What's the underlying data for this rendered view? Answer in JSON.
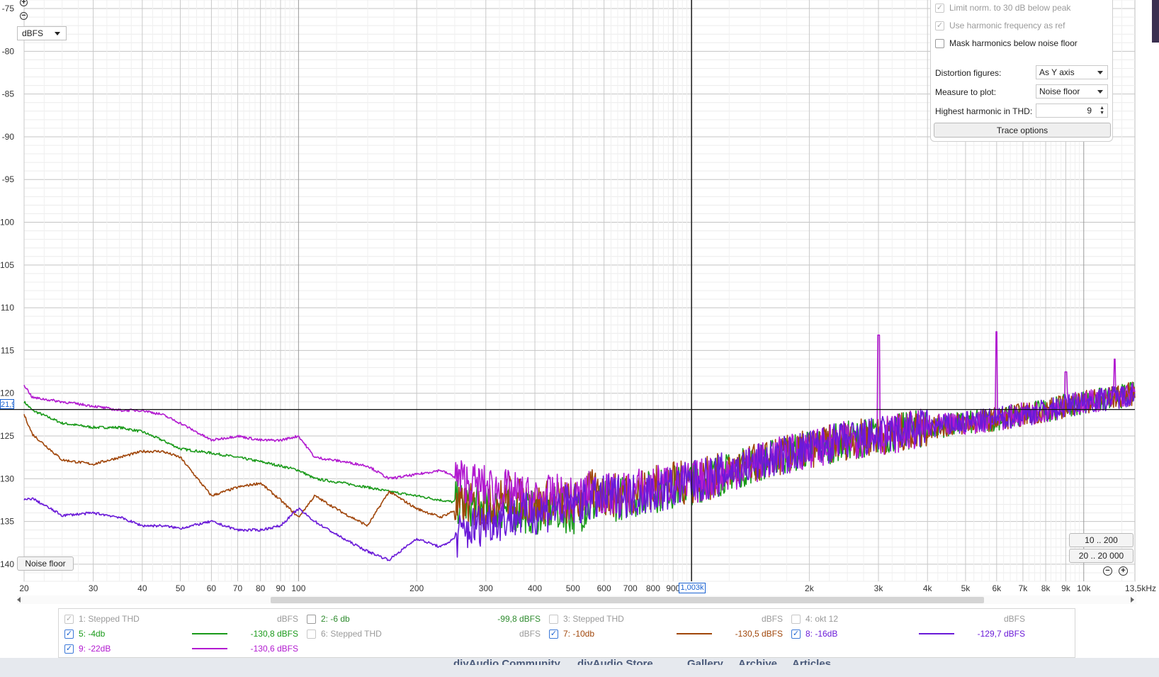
{
  "controls": {
    "unit_select": "dBFS",
    "noise_floor_button": "Noise floor",
    "range_btn_1": "10 .. 200",
    "range_btn_2": "20 .. 20 000",
    "cursor_y_label": "21,9",
    "cursor_x_label": "1,003k"
  },
  "panel": {
    "opt_limit": "Limit norm. to 30 dB below peak",
    "opt_harmonic_ref": "Use harmonic frequency as ref",
    "opt_mask": "Mask harmonics below noise floor",
    "distortion_label": "Distortion figures:",
    "distortion_value": "As Y axis",
    "measure_label": "Measure to plot:",
    "measure_value": "Noise floor",
    "highest_label": "Highest harmonic in THD:",
    "highest_value": "9",
    "trace_options": "Trace options"
  },
  "legend": [
    {
      "name": "1: Stepped THD",
      "value": "dBFS",
      "checked": true,
      "enabled": false,
      "color": "#9a9a9a"
    },
    {
      "name": "2: -6 db",
      "value": "-99,8 dBFS",
      "checked": false,
      "enabled": true,
      "color": "#2e8b2e"
    },
    {
      "name": "3: Stepped THD",
      "value": "dBFS",
      "checked": false,
      "enabled": false,
      "color": "#9a9a9a"
    },
    {
      "name": "4: okt 12",
      "value": "dBFS",
      "checked": false,
      "enabled": false,
      "color": "#9a9a9a"
    },
    {
      "name": "5: -4db",
      "value": "-130,8 dBFS",
      "checked": true,
      "enabled": true,
      "color": "#1a9a1a"
    },
    {
      "name": "6: Stepped THD",
      "value": "dBFS",
      "checked": false,
      "enabled": false,
      "color": "#9a9a9a"
    },
    {
      "name": "7: -10db",
      "value": "-130,5 dBFS",
      "checked": true,
      "enabled": true,
      "color": "#a0460a"
    },
    {
      "name": "8: -16dB",
      "value": "-129,7 dBFS",
      "checked": true,
      "enabled": true,
      "color": "#6a1ad8"
    },
    {
      "name": "9: -22dB",
      "value": "-130,6 dBFS",
      "checked": true,
      "enabled": true,
      "color": "#b21ad0"
    }
  ],
  "bottom_bar": {
    "links": [
      "diyAudio Community",
      "diyAudio Store",
      "Gallery",
      "Archive",
      "Articles"
    ]
  },
  "chart_data": {
    "type": "line",
    "title": "",
    "xlabel": "Hz",
    "ylabel": "dBFS",
    "x_scale": "log",
    "xlim": [
      20,
      13500
    ],
    "ylim": [
      -142,
      -74
    ],
    "grid": true,
    "x_ticks": [
      "20",
      "30",
      "40",
      "50",
      "60",
      "70",
      "80",
      "90",
      "100",
      "200",
      "300",
      "400",
      "500",
      "600",
      "700",
      "800",
      "900",
      "1,003k",
      "2k",
      "3k",
      "4k",
      "5k",
      "6k",
      "7k",
      "8k",
      "9k",
      "10k",
      "13,5kHz"
    ],
    "y_ticks": [
      "-75",
      "-80",
      "-85",
      "-90",
      "-95",
      "100",
      "105",
      "110",
      "115",
      "120",
      "125",
      "130",
      "135",
      "140"
    ],
    "cursor": {
      "x": 1003,
      "y": -121.9
    },
    "series": [
      {
        "name": "7: -10db",
        "color": "#a0460a",
        "x": [
          20,
          21,
          25,
          30,
          35,
          40,
          45,
          50,
          60,
          70,
          80,
          90,
          100,
          110,
          130,
          150,
          170,
          200,
          230,
          270,
          300,
          340,
          400,
          450,
          500,
          560,
          630,
          700,
          800,
          900,
          1000,
          1200,
          1500,
          2000,
          2500,
          3000,
          3500,
          4000,
          5000,
          6000,
          7000,
          8000,
          9000,
          10000,
          12000,
          13500
        ],
        "y": [
          -122.5,
          -124.8,
          -127.8,
          -128.3,
          -127.5,
          -126.8,
          -126.8,
          -127.5,
          -132.0,
          -131.0,
          -130.5,
          -132.5,
          -134.5,
          -132.0,
          -134.0,
          -135.5,
          -131.5,
          -133.5,
          -134.5,
          -133.0,
          -133.5,
          -132.0,
          -133.0,
          -132.5,
          -133.0,
          -131.5,
          -132.0,
          -131.5,
          -131.0,
          -130.5,
          -130.5,
          -129.5,
          -128.0,
          -126.5,
          -125.5,
          -125.0,
          -124.5,
          -124.0,
          -123.5,
          -123.0,
          -122.5,
          -122.0,
          -121.5,
          -121.0,
          -120.5,
          -120.0
        ]
      },
      {
        "name": "5: -4db",
        "color": "#1a9a1a",
        "x": [
          20,
          21,
          25,
          30,
          35,
          40,
          45,
          50,
          60,
          70,
          80,
          90,
          100,
          110,
          130,
          150,
          170,
          200,
          230,
          270,
          300,
          340,
          400,
          450,
          500,
          560,
          630,
          700,
          800,
          900,
          1000,
          1200,
          1500,
          2000,
          2500,
          3000,
          3500,
          4000,
          5000,
          6000,
          7000,
          8000,
          9000,
          10000,
          12000,
          13500
        ],
        "y": [
          -121.0,
          -122.0,
          -123.5,
          -124.0,
          -124.0,
          -124.5,
          -125.5,
          -126.5,
          -127.0,
          -127.5,
          -128.0,
          -128.5,
          -129.0,
          -130.0,
          -130.5,
          -131.0,
          -131.5,
          -132.0,
          -132.5,
          -133.0,
          -133.5,
          -133.5,
          -134.0,
          -133.5,
          -134.0,
          -133.0,
          -132.5,
          -132.0,
          -131.5,
          -131.0,
          -130.5,
          -129.5,
          -128.0,
          -126.5,
          -125.5,
          -125.0,
          -124.5,
          -124.0,
          -123.5,
          -123.0,
          -122.5,
          -122.0,
          -121.5,
          -121.0,
          -120.5,
          -120.0
        ]
      },
      {
        "name": "8: -16dB",
        "color": "#6a1ad8",
        "x": [
          20,
          21,
          25,
          30,
          35,
          40,
          45,
          50,
          60,
          70,
          80,
          90,
          100,
          110,
          130,
          150,
          170,
          200,
          230,
          270,
          300,
          340,
          400,
          450,
          500,
          560,
          630,
          700,
          800,
          900,
          1000,
          1200,
          1500,
          2000,
          2500,
          3000,
          3500,
          4000,
          5000,
          6000,
          7000,
          8000,
          9000,
          10000,
          12000,
          13500
        ],
        "y": [
          -132.5,
          -132.3,
          -134.3,
          -134.0,
          -134.5,
          -135.5,
          -135.5,
          -135.8,
          -135.0,
          -136.0,
          -136.0,
          -135.5,
          -133.5,
          -135.0,
          -137.0,
          -138.5,
          -139.5,
          -137.0,
          -138.0,
          -136.0,
          -135.0,
          -134.5,
          -134.0,
          -133.5,
          -133.0,
          -132.5,
          -132.0,
          -132.0,
          -131.5,
          -131.0,
          -130.5,
          -129.5,
          -128.0,
          -126.5,
          -125.5,
          -125.0,
          -124.5,
          -124.0,
          -123.5,
          -123.0,
          -122.5,
          -122.0,
          -121.5,
          -121.0,
          -120.5,
          -120.0
        ]
      },
      {
        "name": "9: -22dB",
        "color": "#b21ad0",
        "x": [
          20,
          21,
          25,
          30,
          35,
          40,
          45,
          50,
          60,
          70,
          80,
          90,
          100,
          110,
          130,
          150,
          170,
          200,
          230,
          270,
          300,
          340,
          400,
          450,
          500,
          560,
          630,
          700,
          800,
          900,
          1000,
          1200,
          1500,
          2000,
          2500,
          3000,
          3500,
          4000,
          5000,
          6000,
          7000,
          8000,
          9000,
          10000,
          12000,
          13500
        ],
        "y": [
          -119.0,
          -120.5,
          -121.0,
          -121.5,
          -122.0,
          -122.0,
          -122.5,
          -123.5,
          -125.5,
          -125.0,
          -125.5,
          -125.5,
          -125.0,
          -127.5,
          -128.0,
          -128.5,
          -130.0,
          -129.5,
          -129.0,
          -130.5,
          -131.0,
          -131.5,
          -132.5,
          -132.0,
          -132.5,
          -131.5,
          -132.0,
          -131.5,
          -131.0,
          -130.5,
          -130.5,
          -129.5,
          -128.0,
          -126.5,
          -125.5,
          -125.0,
          -124.5,
          -124.0,
          -123.5,
          -123.0,
          -122.5,
          -122.0,
          -121.5,
          -121.0,
          -120.5,
          -120.0
        ],
        "peaks": [
          {
            "x": 3000,
            "y": -113.2
          },
          {
            "x": 6000,
            "y": -112.8
          },
          {
            "x": 9000,
            "y": -117.5
          },
          {
            "x": 12000,
            "y": -116.0
          }
        ]
      }
    ]
  }
}
